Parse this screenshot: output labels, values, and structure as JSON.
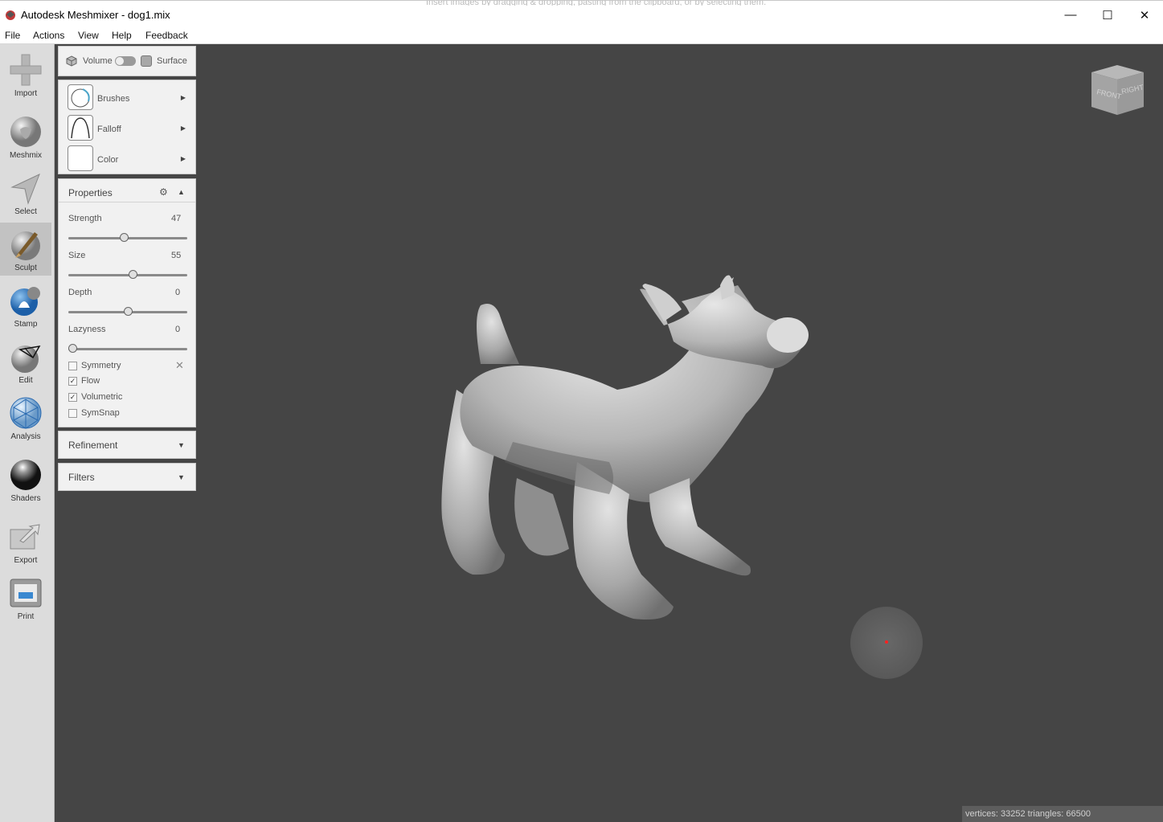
{
  "window": {
    "title": "Autodesk Meshmixer - dog1.mix",
    "background_text": "Insert images by dragging & dropping, pasting from the clipboard, or by selecting them.",
    "controls": {
      "minimize": "—",
      "maximize": "☐",
      "close": "✕"
    }
  },
  "menu": [
    "File",
    "Actions",
    "View",
    "Help",
    "Feedback"
  ],
  "tools": [
    {
      "label": "Import",
      "icon": "plus-icon"
    },
    {
      "label": "Meshmix",
      "icon": "meshmix-head-icon"
    },
    {
      "label": "Select",
      "icon": "select-arrow-icon"
    },
    {
      "label": "Sculpt",
      "icon": "sculpt-brush-icon",
      "active": true
    },
    {
      "label": "Stamp",
      "icon": "stamp-icon"
    },
    {
      "label": "Edit",
      "icon": "edit-icon"
    },
    {
      "label": "Analysis",
      "icon": "analysis-icon"
    },
    {
      "label": "Shaders",
      "icon": "shader-sphere-icon"
    },
    {
      "label": "Export",
      "icon": "export-icon"
    },
    {
      "label": "Print",
      "icon": "printer-icon"
    }
  ],
  "mode_toggle": {
    "left": "Volume",
    "right": "Surface"
  },
  "brush_panel": {
    "brushes": "Brushes",
    "falloff": "Falloff",
    "color": "Color"
  },
  "properties": {
    "title": "Properties",
    "sliders": [
      {
        "label": "Strength",
        "value": "47",
        "fraction": 0.47
      },
      {
        "label": "Size",
        "value": "55",
        "fraction": 0.55
      },
      {
        "label": "Depth",
        "value": "0",
        "fraction": 0.5
      },
      {
        "label": "Lazyness",
        "value": "0",
        "fraction": 0.0
      }
    ],
    "checkboxes": [
      {
        "label": "Symmetry",
        "checked": false
      },
      {
        "label": "Flow",
        "checked": true
      },
      {
        "label": "Volumetric",
        "checked": true
      },
      {
        "label": "SymSnap",
        "checked": false
      }
    ]
  },
  "refinement": {
    "title": "Refinement"
  },
  "filters": {
    "title": "Filters"
  },
  "viewcube": {
    "front": "FRONT",
    "right": "RIGHT"
  },
  "status": {
    "text": "vertices: 33252 triangles: 66500"
  },
  "colors": {
    "viewport": "#454545",
    "panel": "#f1f1f1",
    "toolstrip": "#dcdcdc",
    "brush_cursor_dot": "#ff2020"
  }
}
